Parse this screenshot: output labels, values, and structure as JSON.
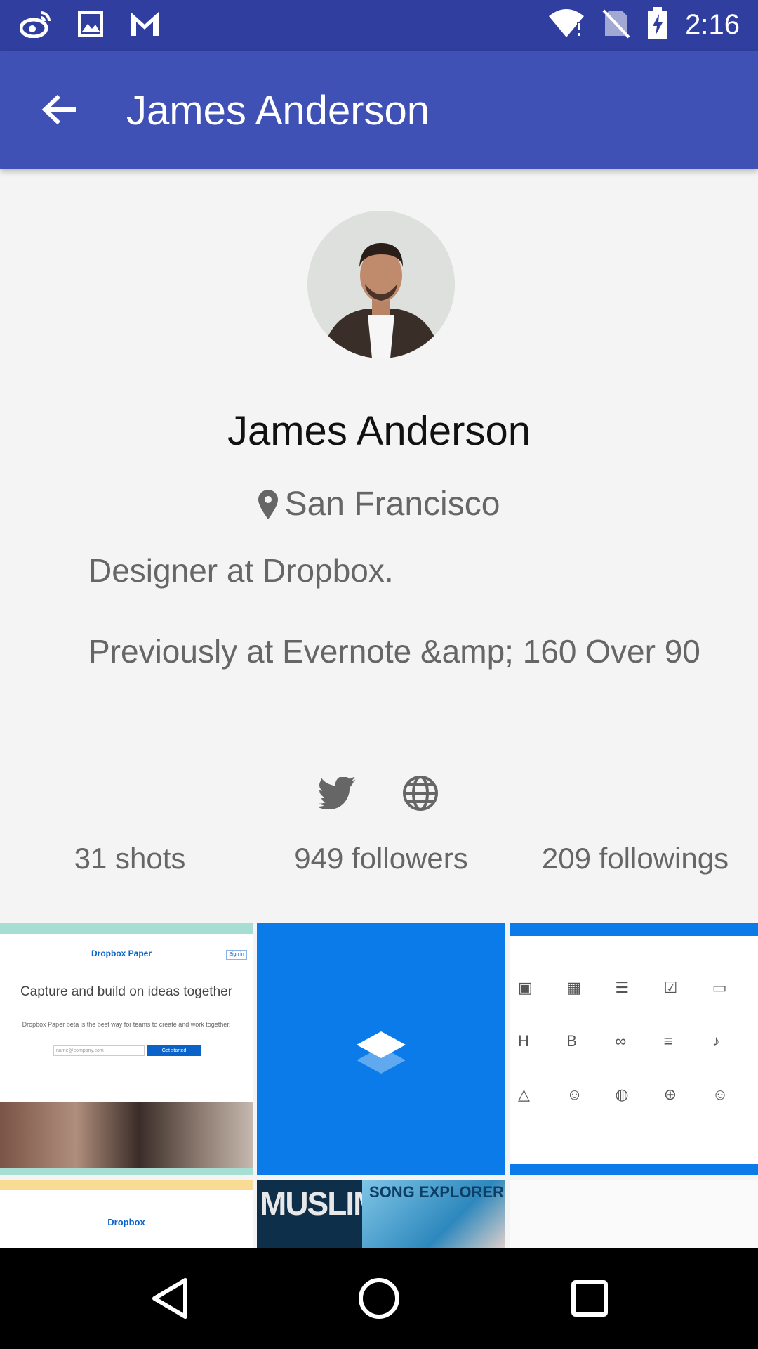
{
  "status_bar": {
    "time": "2:16",
    "icons": [
      "weibo-icon",
      "image-icon",
      "gmail-icon",
      "wifi-icon",
      "no-sim-icon",
      "battery-charging-icon"
    ]
  },
  "app_bar": {
    "title": "James Anderson",
    "back_icon": "arrow-back-icon"
  },
  "profile": {
    "name": "James Anderson",
    "location": "San Francisco",
    "bio_line1": "Designer at Dropbox.",
    "bio_line2": "Previously at Evernote &amp; 160 Over 90",
    "social": [
      "twitter-icon",
      "globe-icon"
    ]
  },
  "stats": {
    "shots": "31 shots",
    "followers": "949 followers",
    "followings": "209 followings"
  },
  "shots": {
    "tile1": {
      "logo": "Dropbox Paper",
      "sign_in": "Sign in",
      "headline": "Capture and build on ideas together",
      "subtext": "Dropbox Paper beta is the best way for teams to create and work together.",
      "input_placeholder": "name@company.com",
      "button": "Get started"
    },
    "tile4": {
      "logo": "Dropbox"
    },
    "tile5": {
      "text1": "MUSLIM",
      "text2": "SONG EXPLORER"
    }
  },
  "nav_bar": {
    "icons": [
      "nav-back-icon",
      "nav-home-icon",
      "nav-recents-icon"
    ]
  },
  "colors": {
    "primary": "#3f51b5",
    "primary_dark": "#303f9f",
    "background": "#f4f4f4",
    "dropbox_blue": "#0a7be8"
  }
}
